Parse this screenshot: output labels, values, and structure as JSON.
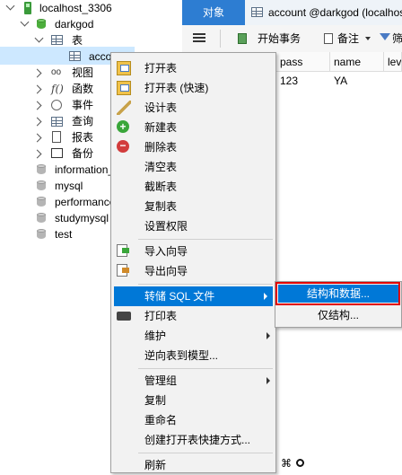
{
  "tree": {
    "connection": "localhost_3306",
    "database": "darkgod",
    "tables_node": "表",
    "selected_table": "account",
    "nodes": [
      "视图",
      "函数",
      "事件",
      "查询",
      "报表",
      "备份"
    ],
    "other_databases": [
      "information_schema",
      "mysql",
      "performance_schema",
      "studymysql",
      "test"
    ]
  },
  "tabs": {
    "objects": "对象",
    "table_tab": "account @darkgod (localhost"
  },
  "toolbar": {
    "begin_transaction": "开始事务",
    "memo": "备注",
    "filter_partial": "筛"
  },
  "grid": {
    "columns": [
      "pass",
      "name",
      "lev"
    ],
    "row": [
      "123",
      "YA",
      ""
    ]
  },
  "context_menu": {
    "items": [
      "打开表",
      "打开表 (快速)",
      "设计表",
      "新建表",
      "删除表",
      "清空表",
      "截断表",
      "复制表",
      "设置权限",
      "导入向导",
      "导出向导",
      "转储 SQL 文件",
      "打印表",
      "维护",
      "逆向表到模型...",
      "管理组",
      "复制",
      "重命名",
      "创建打开表快捷方式...",
      "刷新"
    ]
  },
  "submenu": {
    "items": [
      "结构和数据...",
      "仅结构..."
    ]
  },
  "colors": {
    "accent": "#0078d7",
    "tab_active": "#2d7dd2",
    "highlight_box": "#e00000",
    "tree_selection": "#cde8ff"
  }
}
